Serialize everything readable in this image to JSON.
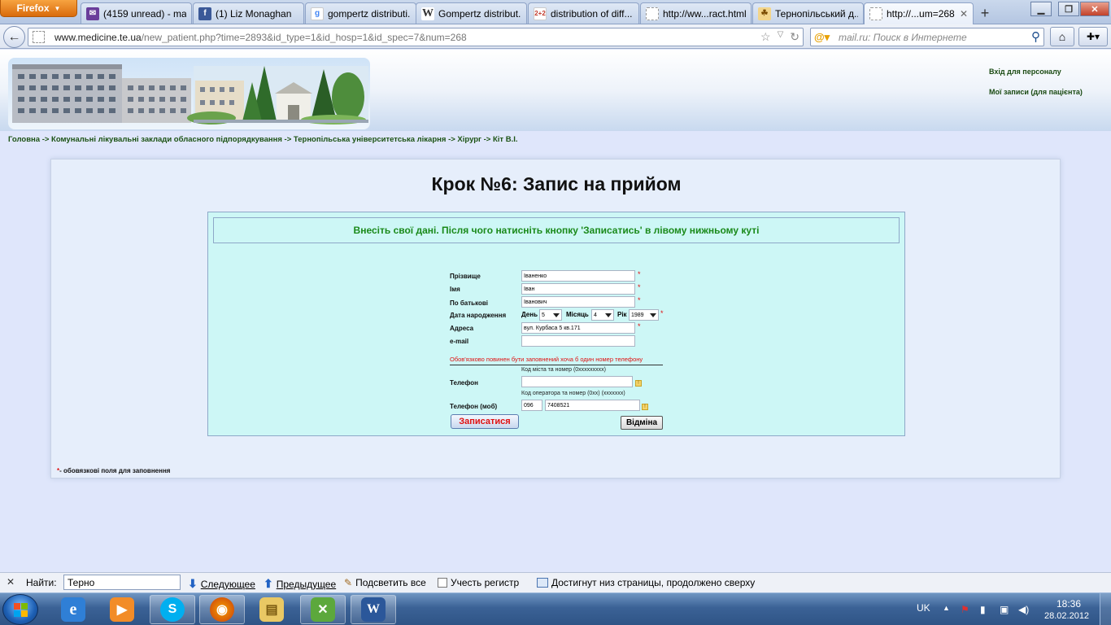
{
  "browser": {
    "menu_button": "Firefox",
    "tabs": [
      {
        "title": "(4159 unread) - ma...",
        "icon": "mail-icon",
        "color": "#6a3d9a"
      },
      {
        "title": "(1) Liz Monaghan",
        "icon": "facebook-icon",
        "color": "#3b5998"
      },
      {
        "title": "gompertz distributi...",
        "icon": "google-icon",
        "color": "#4285f4"
      },
      {
        "title": "Gompertz distribut...",
        "icon": "wikipedia-icon",
        "color": "#333333"
      },
      {
        "title": "distribution of diff...",
        "icon": "math-icon",
        "color": "#c0392b"
      },
      {
        "title": "http://ww...ract.html",
        "icon": "blank-page-icon",
        "color": "#999999"
      },
      {
        "title": "Тернопільський д...",
        "icon": "hospital-icon",
        "color": "#e0a030"
      },
      {
        "title": "http://...um=268",
        "icon": "blank-page-icon",
        "color": "#999999"
      }
    ],
    "url_domain": "www.medicine.te.ua",
    "url_path": "/new_patient.php?time=2893&id_type=1&id_hosp=1&id_spec=7&num=268",
    "search_placeholder": "mail.ru: Поиск в Интернете"
  },
  "header": {
    "staff_login": "Вхід для персоналу",
    "my_records": "Мої записи (для пацієнта)"
  },
  "breadcrumb": "Головна -> Комунальні лікувальні заклади обласного підпорядкування -> Тернопільська університетська лікарня -> Хірург -> Кіт В.І.",
  "form": {
    "step_title": "Крок №6: Запис на прийом",
    "instruction": "Внесіть свої дані. Після чого натисніть кнопку 'Записатись' в лівому нижньому куті",
    "fields": {
      "surname_label": "Прізвище",
      "surname_value": "Іваненко",
      "name_label": "Імя",
      "name_value": "Іван",
      "patronymic_label": "По батькові",
      "patronymic_value": "Іванович",
      "birthdate_label": "Дата народження",
      "day_label": "День",
      "day_value": "5",
      "month_label": "Місяць",
      "month_value": "4",
      "year_label": "Рік",
      "year_value": "1989",
      "address_label": "Адреса",
      "address_value": "вул. Курбаса 5 кв.171",
      "email_label": "e-mail",
      "email_value": ""
    },
    "required_mark": "*",
    "phone_warning": "Обов'язково повинен бути заповнений хоча б один номер телефону",
    "phone_hint": "Код міста та номер (0xxxxxxxxx)",
    "phone_label": "Телефон",
    "phone_value": "",
    "mobile_hint": "Код оператора та номер (0xx) (xxxxxxx)",
    "mobile_label": "Телефон (моб)",
    "mobile_code": "096",
    "mobile_number": "7408521",
    "submit_label": "Записатися",
    "cancel_label": "Відміна",
    "required_note": "- обовязкові поля для заповнення"
  },
  "findbar": {
    "label": "Найти:",
    "query": "Терно",
    "next": "Следующее",
    "prev": "Предыдущее",
    "highlight": "Подсветить все",
    "match_case": "Учесть регистр",
    "status": "Достигнут низ страницы, продолжено сверху"
  },
  "taskbar": {
    "language": "UK",
    "time": "18:36",
    "date": "28.02.2012"
  },
  "colors": {
    "accent_green": "#1a8a1a",
    "required_red": "#e01010",
    "form_bg": "#cdf7f6"
  }
}
